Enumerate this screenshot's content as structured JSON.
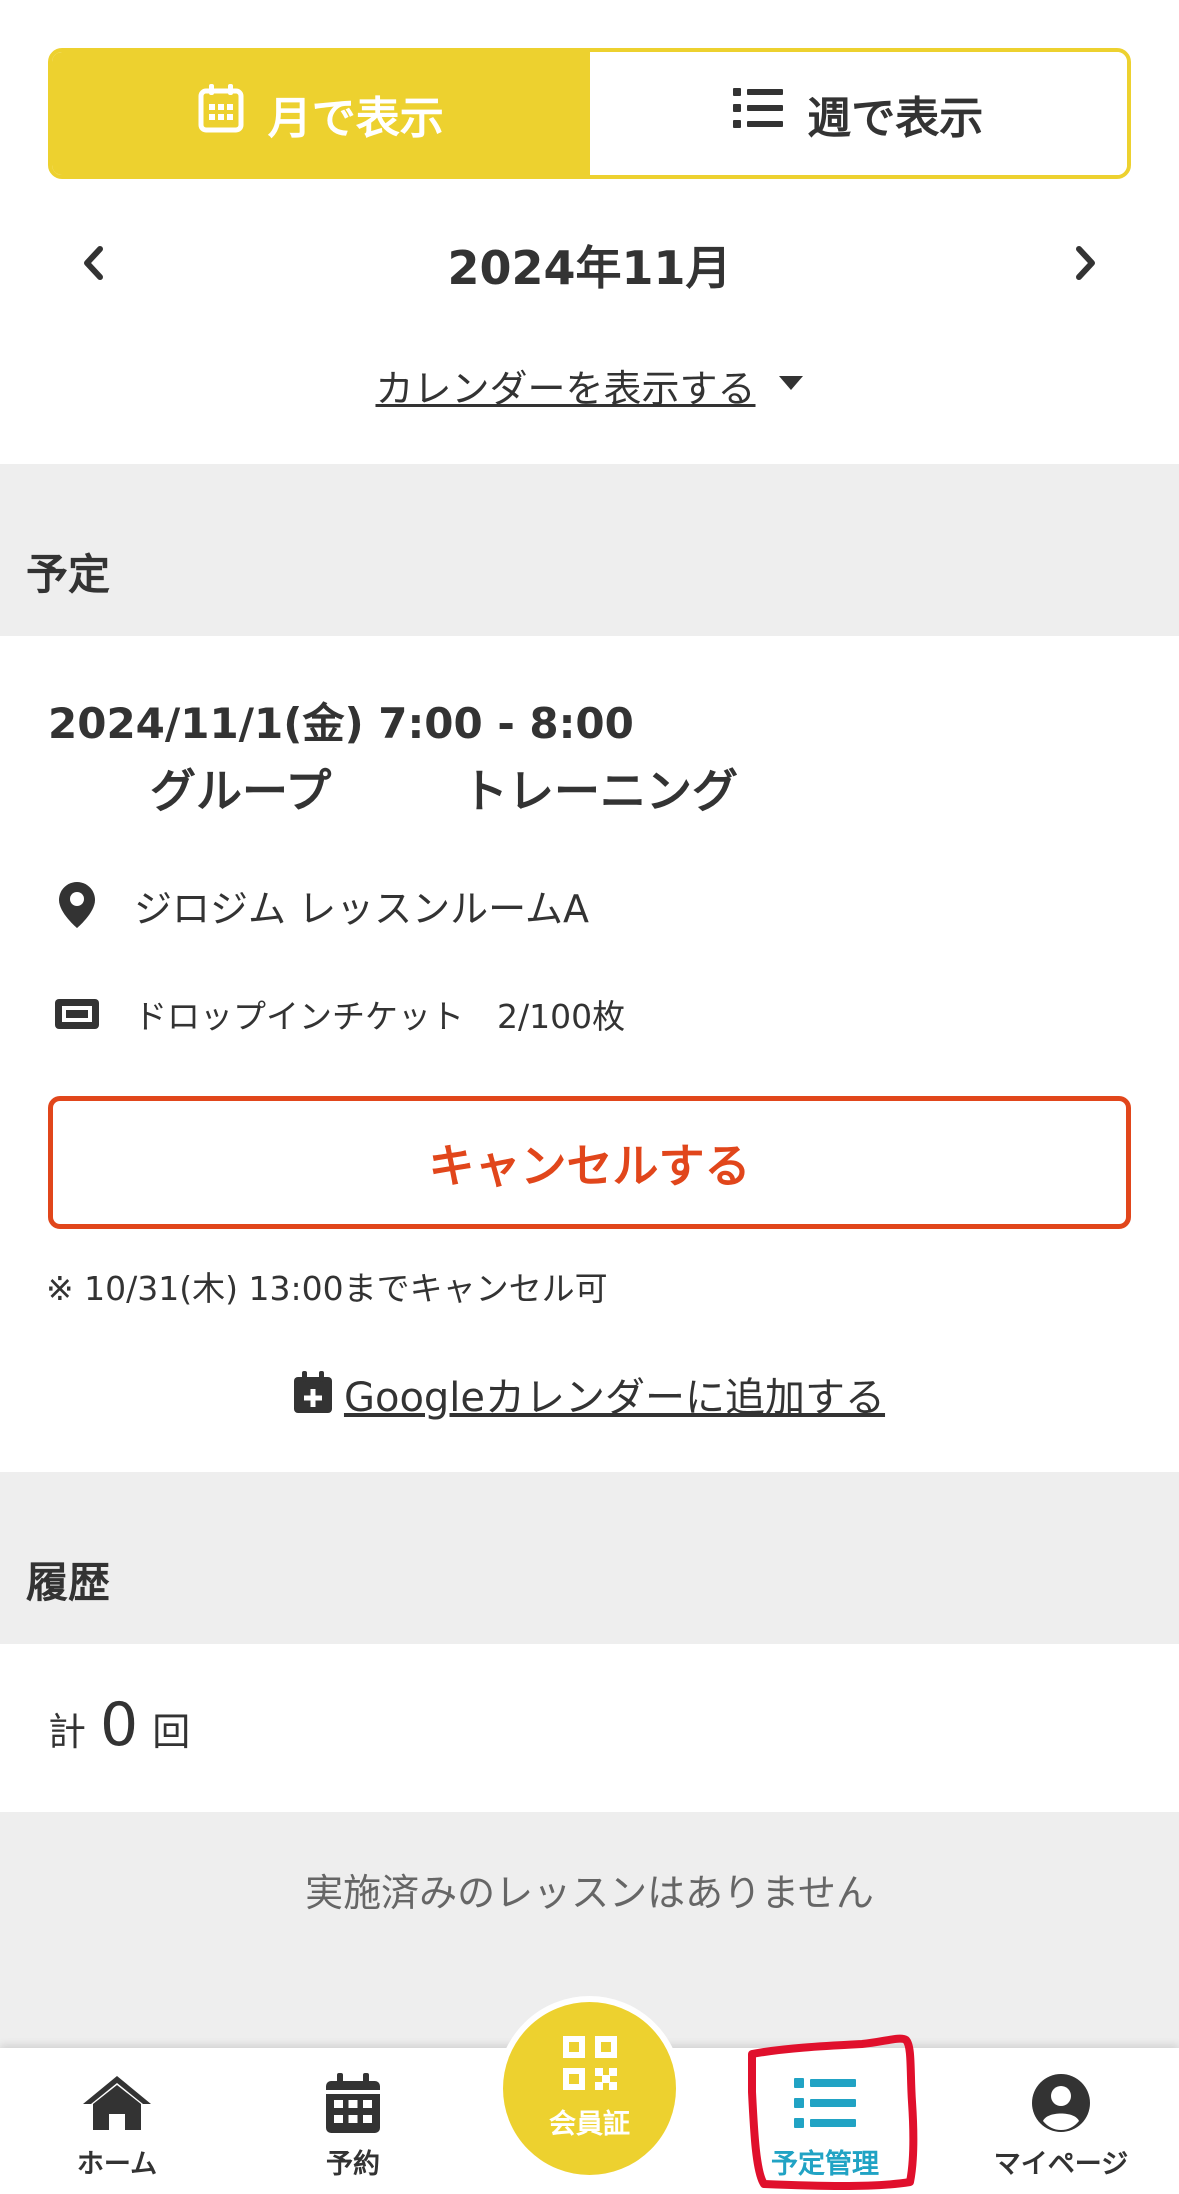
{
  "view_toggle": {
    "month_label": "月で表示",
    "week_label": "週で表示"
  },
  "month_nav": {
    "title": "2024年11月"
  },
  "calendar_toggle": {
    "label": "カレンダーを表示する"
  },
  "schedule": {
    "section_title": "予定",
    "event": {
      "datetime": "2024/11/1(金) 7:00 - 8:00",
      "name_part1": "グループ",
      "name_part2": "トレーニング",
      "location": "ジロジム レッスンルームA",
      "ticket": "ドロップインチケット　2/100枚"
    },
    "cancel_button": "キャンセルする",
    "cancel_note": "※ 10/31(木) 13:00までキャンセル可",
    "gcal_link": "Googleカレンダーに追加する"
  },
  "history": {
    "section_title": "履歴",
    "total_prefix": "計",
    "total_count": "0",
    "total_suffix": "回",
    "empty_text": "実施済みのレッスンはありません"
  },
  "tabbar": {
    "home": "ホーム",
    "reserve": "予約",
    "member_card": "会員証",
    "schedule": "予定管理",
    "mypage": "マイページ"
  },
  "colors": {
    "accent_yellow": "#EDD12F",
    "cancel_red": "#E1461B",
    "active_tab_blue": "#21A3C4",
    "highlight_red": "#E0102C",
    "section_gray": "#EEEEEE"
  }
}
